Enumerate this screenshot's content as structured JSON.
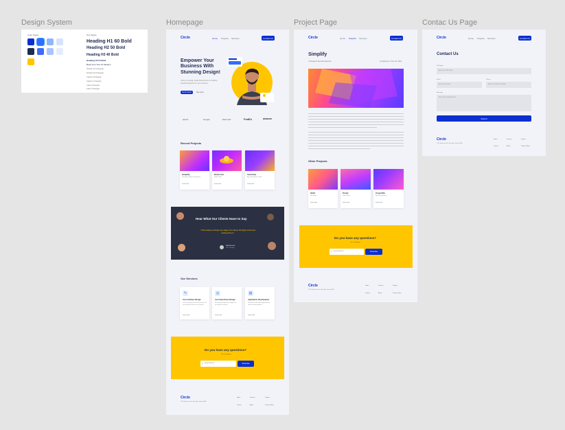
{
  "labels": {
    "design_system": "Design System",
    "homepage": "Homepage",
    "project_page": "Project Page",
    "contact_page": "Contac Us Page"
  },
  "design_system": {
    "color_styles_title": "Color Styles",
    "text_styles_title": "Text Styles",
    "h1": "Heading H1 60 Bold",
    "h2": "Heading H2 50 Bold",
    "h3": "Heading H3 40 Bold",
    "h4": "Heading H4 24 Bold",
    "body_intro": "Body Intro Text 24 Medium",
    "small_lines": [
      "Subtitle S1 24 Regular",
      "Subtitle S2 20 Regular",
      "Caption 16 Regular",
      "Caption 14 Regular",
      "Label 12 Regular",
      "Label 10 Regular"
    ],
    "colors": [
      "#0b2fd1",
      "#2f6fff",
      "#8fb6ff",
      "#d4e3ff",
      "#1e2a52",
      "#3d6cf7",
      "#a9c4ff",
      "#e4edff",
      "#ffc600"
    ]
  },
  "home": {
    "logo": "Circle",
    "nav": [
      "Home",
      "Projects",
      "Services"
    ],
    "cta": "Contact Us",
    "hero_title": "Empower Your Business With Stunning Design!",
    "hero_text": "Circle is a design studio that focuses on building beautiful products for your business.",
    "hero_btn1": "Get in touch",
    "hero_btn2": "See more",
    "brands": [
      "airbnb",
      "Google",
      "Microsoft",
      "FedEx",
      "amazon"
    ],
    "recent_title": "Recent Projects",
    "projects": [
      {
        "name": "Simplify",
        "sub": "UI Design & App Development",
        "link": "Learn more"
      },
      {
        "name": "Darkroom",
        "sub": "Web Design",
        "link": "Learn more"
      },
      {
        "name": "Vestimity",
        "sub": "App Development, Web",
        "link": "Learn more"
      }
    ],
    "testimonial_title": "Hear What Our Clients Have to Say",
    "testimonial_quote": "\"Circle helped us through every stage of our startup. We highly recommend working with you.\"",
    "testimonial_author": "Rob Marshall",
    "testimonial_role": "CEO, Simplify",
    "services_title": "Our Services",
    "services": [
      {
        "name": "User Interface Design",
        "desc": "Circle can help you create an attractive and user-friendly interface for your product.",
        "link": "Learn more"
      },
      {
        "name": "User Experience Design",
        "desc": "We design for people first, making sure your product is intuitive.",
        "link": "Learn more"
      },
      {
        "name": "Application Development",
        "desc": "We build fast and reliable applications for web and mobile platforms.",
        "link": "Learn more"
      }
    ],
    "question_title": "Do you have any questions?",
    "question_sub": "Let us help you",
    "email_placeholder": "Email address",
    "send": "Subscribe",
    "footer_logo": "Circle",
    "footer_address": "2972 Westheimer Rd. Santa Ana, Illinois 85486",
    "footer_links": [
      "Home",
      "Services",
      "Projects",
      "Contact",
      "About",
      "Privacy Policy"
    ]
  },
  "project": {
    "logo": "Circle",
    "nav": [
      "Home",
      "Projects",
      "Services"
    ],
    "cta": "Contact Us",
    "title": "Simplify",
    "subtitle": "UI Design & App Development",
    "date": "Completed on June 24, 2021",
    "other_title": "Other Projects",
    "others": [
      {
        "name": "Orbit",
        "sub": "UI Design",
        "link": "Learn more"
      },
      {
        "name": "Purity",
        "sub": "Web Design",
        "link": "Learn more"
      },
      {
        "name": "Cryptoflw",
        "sub": "App Development",
        "link": "Learn more"
      }
    ],
    "question_title": "Do you have any questions?",
    "question_sub": "Let us help you",
    "email_placeholder": "Email address",
    "send": "Subscribe",
    "footer_logo": "Circle",
    "footer_address": "2972 Westheimer Rd. Santa Ana, Illinois 85486",
    "footer_links": [
      "Home",
      "Services",
      "Projects",
      "Contact",
      "About",
      "Privacy Policy"
    ]
  },
  "contact": {
    "logo": "Circle",
    "nav": [
      "Home",
      "Projects",
      "Services"
    ],
    "cta": "Contact Us",
    "title": "Contact Us",
    "full_name_label": "Full Name",
    "full_name_placeholder": "Enter your full name",
    "email_label": "Email",
    "email_placeholder": "Enter your email",
    "phone_label": "Phone",
    "phone_placeholder": "Enter your phone number",
    "message_label": "Message",
    "message_placeholder": "Write your message here",
    "submit": "Submit",
    "footer_logo": "Circle",
    "footer_address": "2972 Westheimer Rd. Santa Ana, Illinois 85486",
    "footer_links": [
      "Home",
      "Services",
      "Projects",
      "Contact",
      "About",
      "Privacy Policy"
    ]
  }
}
